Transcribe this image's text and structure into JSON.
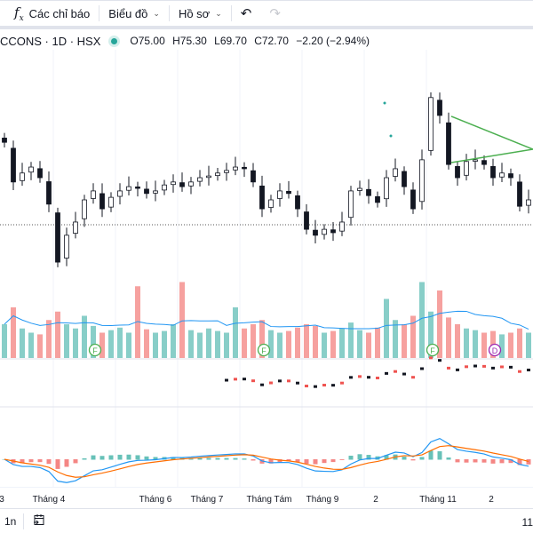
{
  "toolbar": {
    "indicators_label": "Các chỉ báo",
    "chart_label": "Biểu đồ",
    "profile_label": "Hồ sơ",
    "icons": [
      "fx-icon",
      "chevron-down-icon",
      "undo-icon",
      "redo-icon"
    ]
  },
  "legend": {
    "symbol": "CCONS · 1D · HSX",
    "status_color": "#26a69a",
    "open": "O75.00",
    "high": "H75.30",
    "low": "L69.70",
    "close": "C72.70",
    "change": "−2.20 (−2.94%)"
  },
  "colors": {
    "up": "#26a69a",
    "down": "#ef5350",
    "volume_ma": "#2196f3",
    "macd": "#2196f3",
    "signal": "#ff6d00",
    "trendline": "#4caf50",
    "event_dividend": "#4caf50",
    "event_d": "#9c27b0"
  },
  "chart_data": {
    "type": "candlestick",
    "closes": [
      86.2,
      76.9,
      79.0,
      80.4,
      77.9,
      71.7,
      58.1,
      64.4,
      67.5,
      72.7,
      74.8,
      70.6,
      73.3,
      74.8,
      75.8,
      75.4,
      74.2,
      74.8,
      76.2,
      76.9,
      75.8,
      76.9,
      77.9,
      78.3,
      79.0,
      79.6,
      80.4,
      80.0,
      76.9,
      70.6,
      72.7,
      74.8,
      74.2,
      70.6,
      65.8,
      64.4,
      65.8,
      65.0,
      67.5,
      74.8,
      75.4,
      73.7,
      72.1,
      77.9,
      80.0,
      75.8,
      70.6,
      82.1,
      96.7,
      92.5,
      81.0,
      77.9,
      81.7,
      82.1,
      81.0,
      77.9,
      79.0,
      77.9,
      71.2,
      72.7
    ],
    "volumes": [
      40,
      60,
      35,
      30,
      28,
      45,
      55,
      40,
      35,
      50,
      38,
      30,
      33,
      36,
      30,
      85,
      34,
      30,
      32,
      40,
      90,
      33,
      30,
      35,
      32,
      30,
      60,
      35,
      40,
      45,
      33,
      30,
      32,
      36,
      40,
      38,
      30,
      32,
      35,
      42,
      33,
      30,
      36,
      70,
      45,
      40,
      50,
      90,
      55,
      80,
      48,
      40,
      35,
      33,
      30,
      32,
      28,
      30,
      35,
      30
    ],
    "events": [
      {
        "label": "F",
        "index": 10
      },
      {
        "label": "F",
        "index": 29
      },
      {
        "label": "F",
        "index": 48
      },
      {
        "label": "D",
        "index": 55
      }
    ],
    "x_ticks": [
      {
        "label": "3",
        "index": 0
      },
      {
        "label": "Tháng 4",
        "index": 5
      },
      {
        "label": "Tháng 6",
        "index": 17
      },
      {
        "label": "Tháng 7",
        "index": 23
      },
      {
        "label": "Tháng Tám",
        "index": 30
      },
      {
        "label": "Tháng 9",
        "index": 36
      },
      {
        "label": "2",
        "index": 42
      },
      {
        "label": "Tháng 11",
        "index": 49
      },
      {
        "label": "2",
        "index": 55
      }
    ],
    "indicators": [
      "Volume",
      "MA",
      "MACD"
    ]
  },
  "bottombar": {
    "range_label": "1n",
    "right_label": "11"
  }
}
